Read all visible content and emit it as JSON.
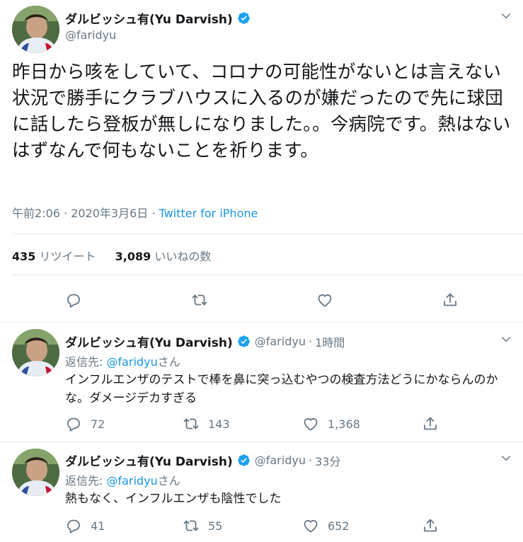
{
  "main_tweet": {
    "display_name": "ダルビッシュ有(Yu Darvish)",
    "handle": "@faridyu",
    "text": "昨日から咳をしていて、コロナの可能性がないとは言えない状況で勝手にクラブハウスに入るのが嫌だったので先に球団に話したら登板が無しになりました。。今病院です。熱はないはずなんで何もないことを祈ります。",
    "timestamp": "午前2:06 · 2020年3月6日 · ",
    "source": "Twitter for iPhone",
    "retweet_count": "435",
    "retweet_label": "リツイート",
    "like_count": "3,089",
    "like_label": "いいねの数"
  },
  "replies": [
    {
      "display_name": "ダルビッシュ有(Yu Darvish)",
      "handle": "@faridyu",
      "time": "1時間",
      "reply_prefix": "返信先: ",
      "reply_mention": "@faridyu",
      "reply_suffix": "さん",
      "text": "インフルエンザのテストで棒を鼻に突っ込むやつの検査方法どうにかならんのかな。ダメージデカすぎる",
      "reply_count": "72",
      "retweet_count": "143",
      "like_count": "1,368"
    },
    {
      "display_name": "ダルビッシュ有(Yu Darvish)",
      "handle": "@faridyu",
      "time": "33分",
      "reply_prefix": "返信先: ",
      "reply_mention": "@faridyu",
      "reply_suffix": "さん",
      "text": "熱もなく、インフルエンザも陰性でした",
      "reply_count": "41",
      "retweet_count": "55",
      "like_count": "652"
    }
  ],
  "icons": [
    "verified-icon",
    "chevron-down-icon",
    "reply-icon",
    "retweet-icon",
    "like-icon",
    "share-icon"
  ],
  "colors": {
    "text": "#14171a",
    "muted": "#657786",
    "link": "#1b95e0",
    "verified": "#1da1f2",
    "divider": "#e6ecf0"
  }
}
